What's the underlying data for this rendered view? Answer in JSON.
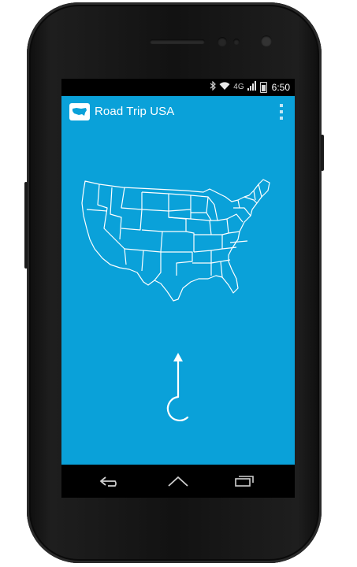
{
  "status_bar": {
    "bluetooth_icon": "bluetooth-icon",
    "wifi_icon": "wifi-icon",
    "network_type": "4G",
    "signal_icon": "signal-icon",
    "battery_icon": "battery-icon",
    "time": "6:50"
  },
  "action_bar": {
    "logo_icon": "usa-map-icon",
    "title": "Road Trip USA",
    "overflow_icon": "overflow-menu-icon"
  },
  "main": {
    "map_icon": "usa-states-outline",
    "direction_icon": "turn-arrow-icon",
    "background_color": "#0aa1d9"
  },
  "nav_bar": {
    "back_icon": "back-icon",
    "home_icon": "home-icon",
    "recents_icon": "recents-icon"
  }
}
